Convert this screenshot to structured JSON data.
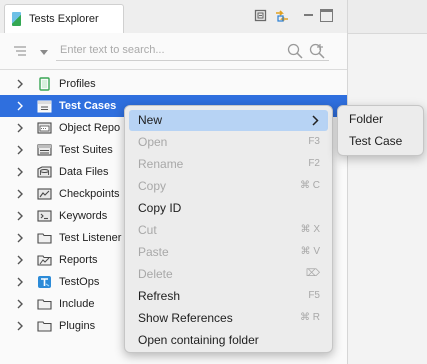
{
  "panel": {
    "title": "Tests Explorer"
  },
  "search": {
    "placeholder": "Enter text to search..."
  },
  "tree": {
    "items": [
      {
        "label": "Profiles",
        "icon": "profile-icon"
      },
      {
        "label": "Test Cases",
        "icon": "test-case-folder-icon",
        "selected": true
      },
      {
        "label": "Object Repo",
        "icon": "object-repository-icon"
      },
      {
        "label": "Test Suites",
        "icon": "test-suite-icon"
      },
      {
        "label": "Data Files",
        "icon": "data-files-icon"
      },
      {
        "label": "Checkpoints",
        "icon": "checkpoint-icon"
      },
      {
        "label": "Keywords",
        "icon": "keywords-icon"
      },
      {
        "label": "Test Listener",
        "icon": "folder-icon"
      },
      {
        "label": "Reports",
        "icon": "reports-icon"
      },
      {
        "label": "TestOps",
        "icon": "testops-icon"
      },
      {
        "label": "Include",
        "icon": "folder-icon"
      },
      {
        "label": "Plugins",
        "icon": "folder-icon"
      }
    ]
  },
  "context_menu": {
    "items": [
      {
        "label": "New",
        "shortcut": "",
        "enabled": true,
        "submenu": true
      },
      {
        "label": "Open",
        "shortcut": "F3",
        "enabled": false
      },
      {
        "label": "Rename",
        "shortcut": "F2",
        "enabled": false
      },
      {
        "label": "Copy",
        "shortcut": "⌘ C",
        "enabled": false
      },
      {
        "label": "Copy ID",
        "shortcut": "",
        "enabled": true
      },
      {
        "label": "Cut",
        "shortcut": "⌘ X",
        "enabled": false
      },
      {
        "label": "Paste",
        "shortcut": "⌘ V",
        "enabled": false
      },
      {
        "label": "Delete",
        "shortcut": "⌦",
        "enabled": false
      },
      {
        "label": "Refresh",
        "shortcut": "F5",
        "enabled": true
      },
      {
        "label": "Show References",
        "shortcut": "⌘ R",
        "enabled": true
      },
      {
        "label": "Open containing folder",
        "shortcut": "",
        "enabled": true
      }
    ]
  },
  "submenu": {
    "items": [
      {
        "label": "Folder"
      },
      {
        "label": "Test Case"
      }
    ]
  },
  "colors": {
    "selection": "#2f6fde",
    "menu_highlight": "#b7d3f4",
    "disabled_text": "#a8a8a8"
  }
}
